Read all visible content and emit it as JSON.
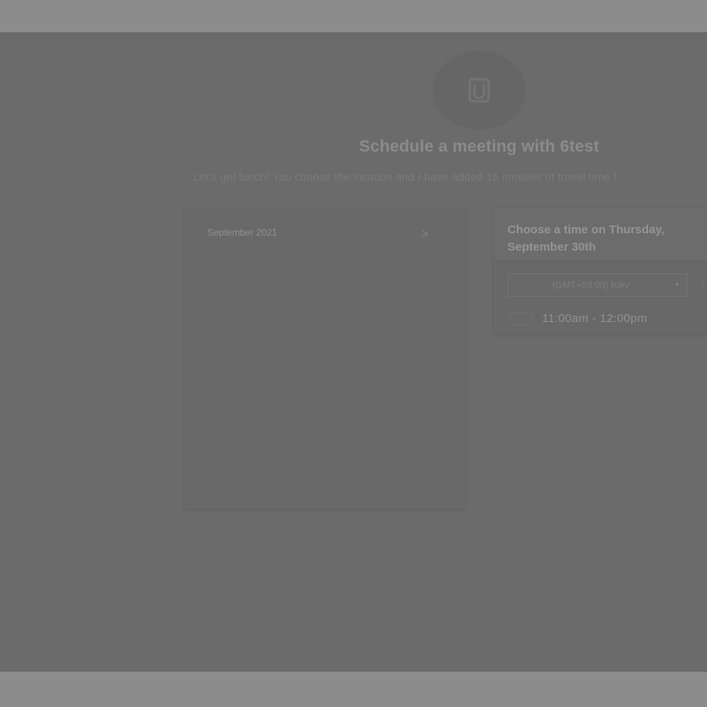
{
  "meeting": {
    "title": "Schedule a meeting with 6test",
    "description": "Let's get lunch! You choose the location and I have added 15 minutes of travel time f"
  },
  "avatar": {
    "icon": "logo-icon"
  },
  "calendar": {
    "month": "September 2021",
    "next_icon": ">"
  },
  "slots": {
    "heading": "Choose a time on Thursday, September 30th",
    "timezone": "(GMT+03:00) Kiev",
    "timezone_caret": "▾",
    "timezone_extra": "i",
    "items": [
      {
        "time": "11:00am - 12:00pm"
      }
    ]
  }
}
